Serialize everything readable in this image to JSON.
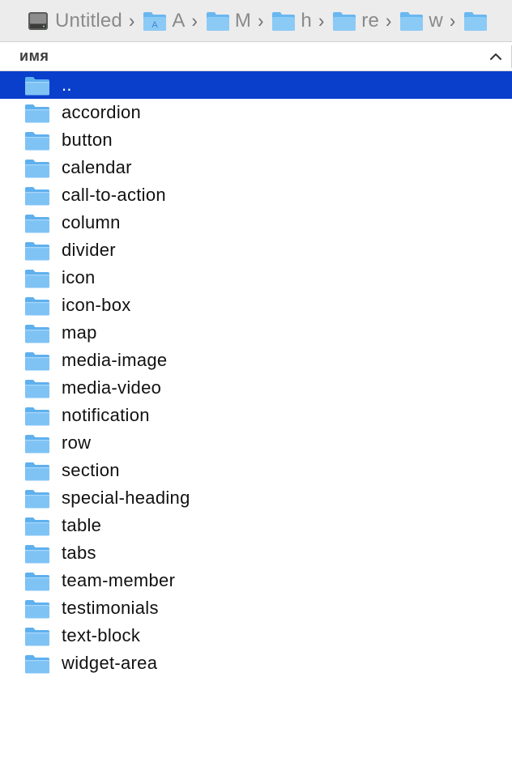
{
  "pathbar": {
    "crumbs": [
      {
        "label": "Untitled",
        "icon": "disk-icon"
      },
      {
        "label": "A",
        "icon": "applications-folder-icon"
      },
      {
        "label": "M",
        "icon": "folder-icon"
      },
      {
        "label": "h",
        "icon": "folder-icon"
      },
      {
        "label": "re",
        "icon": "folder-icon"
      },
      {
        "label": "w",
        "icon": "folder-icon"
      },
      {
        "label": "",
        "icon": "folder-icon"
      }
    ],
    "separator": "›"
  },
  "column_header": {
    "label": "имя",
    "sort": "ascending"
  },
  "files": [
    {
      "name": "..",
      "selected": true
    },
    {
      "name": "accordion"
    },
    {
      "name": "button"
    },
    {
      "name": "calendar"
    },
    {
      "name": "call-to-action"
    },
    {
      "name": "column"
    },
    {
      "name": "divider"
    },
    {
      "name": "icon"
    },
    {
      "name": "icon-box"
    },
    {
      "name": "map"
    },
    {
      "name": "media-image"
    },
    {
      "name": "media-video"
    },
    {
      "name": "notification"
    },
    {
      "name": "row"
    },
    {
      "name": "section"
    },
    {
      "name": "special-heading"
    },
    {
      "name": "table"
    },
    {
      "name": "tabs"
    },
    {
      "name": "team-member"
    },
    {
      "name": "testimonials"
    },
    {
      "name": "text-block"
    },
    {
      "name": "widget-area"
    }
  ],
  "colors": {
    "selection": "#0a3fcc",
    "folder": "#6ab7f0",
    "pathbar_bg": "#ececec"
  }
}
